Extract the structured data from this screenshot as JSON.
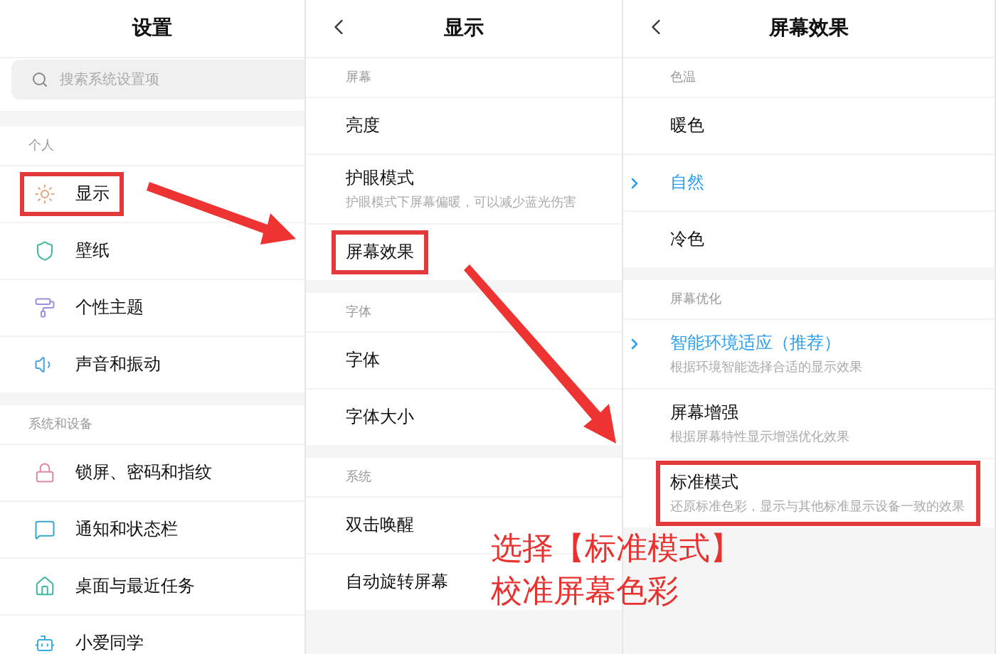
{
  "panels": [
    {
      "title": "设置",
      "back": false,
      "search": {
        "placeholder": "搜索系统设置项"
      },
      "sections": [
        {
          "header": "个人",
          "items": [
            {
              "label": "显示",
              "highlighted": true
            },
            {
              "label": "壁纸",
              "highlighted": false
            },
            {
              "label": "个性主题",
              "highlighted": false
            },
            {
              "label": "声音和振动",
              "highlighted": false
            }
          ]
        },
        {
          "header": "系统和设备",
          "items": [
            {
              "label": "锁屏、密码和指纹",
              "highlighted": false
            },
            {
              "label": "通知和状态栏",
              "highlighted": false
            },
            {
              "label": "桌面与最近任务",
              "highlighted": false
            },
            {
              "label": "小爱同学",
              "highlighted": false
            }
          ]
        }
      ]
    },
    {
      "title": "显示",
      "back": true,
      "sections": [
        {
          "header": "屏幕",
          "items": [
            {
              "label": "亮度",
              "highlighted": false
            },
            {
              "label": "护眼模式",
              "subtitle": "护眼模式下屏幕偏暖，可以减少蓝光伤害",
              "highlighted": false
            },
            {
              "label": "屏幕效果",
              "highlighted": true
            }
          ]
        },
        {
          "header": "字体",
          "items": [
            {
              "label": "字体",
              "highlighted": false
            },
            {
              "label": "字体大小",
              "highlighted": false
            }
          ]
        },
        {
          "header": "系统",
          "items": [
            {
              "label": "双击唤醒",
              "highlighted": false
            },
            {
              "label": "自动旋转屏幕",
              "highlighted": false
            }
          ]
        }
      ]
    },
    {
      "title": "屏幕效果",
      "back": true,
      "sections": [
        {
          "header": "色温",
          "items": [
            {
              "label": "暖色",
              "selected": false,
              "highlighted": false
            },
            {
              "label": "自然",
              "selected": true,
              "highlighted": false
            },
            {
              "label": "冷色",
              "selected": false,
              "highlighted": false
            }
          ]
        },
        {
          "header": "屏幕优化",
          "items": [
            {
              "label": "智能环境适应（推荐）",
              "subtitle": "根据环境智能选择合适的显示效果",
              "selected": true,
              "highlighted": false
            },
            {
              "label": "屏幕增强",
              "subtitle": "根据屏幕特性显示增强优化效果",
              "selected": false,
              "highlighted": false
            },
            {
              "label": "标准模式",
              "subtitle": "还原标准色彩，显示与其他标准显示设备一致的效果",
              "selected": false,
              "highlighted": true
            }
          ]
        }
      ]
    }
  ],
  "annotation": {
    "lines": [
      "选择【标准模式】",
      "校准屏幕色彩"
    ]
  }
}
